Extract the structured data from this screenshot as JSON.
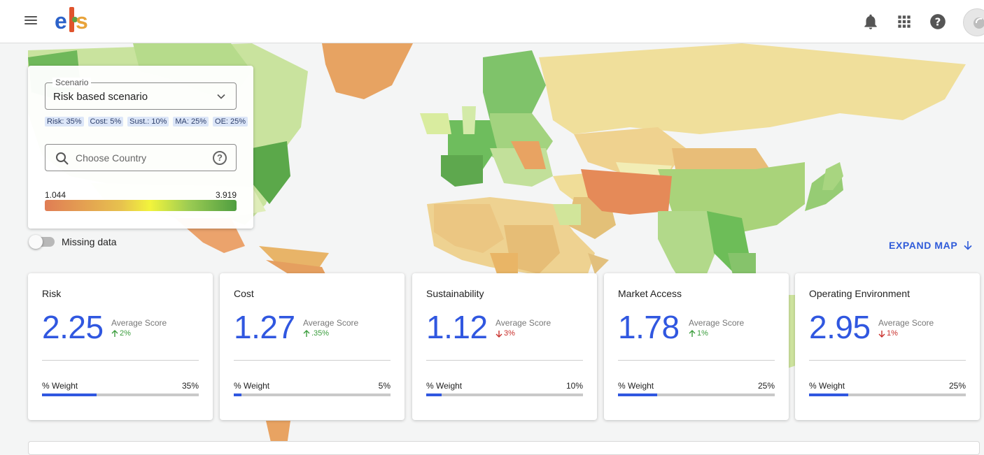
{
  "header": {
    "logo_text": "els",
    "icons": [
      "menu-icon",
      "bell-icon",
      "apps-grid-icon",
      "help-icon",
      "avatar"
    ]
  },
  "scenario": {
    "legend": "Scenario",
    "selected": "Risk based scenario",
    "weights": [
      "Risk: 35%",
      "Cost: 5%",
      "Sust.: 10%",
      "MA: 25%",
      "OE: 25%"
    ]
  },
  "search": {
    "placeholder": "Choose Country",
    "help": "?"
  },
  "scale": {
    "min": "1.044",
    "max": "3.919",
    "colors": [
      "#e07d55",
      "#e7c24e",
      "#f2f43c",
      "#9ccc53",
      "#4f9e40"
    ]
  },
  "missing_data": {
    "label": "Missing data",
    "enabled": false
  },
  "expand_map": {
    "label": "EXPAND MAP"
  },
  "accent_color": "#3057e0",
  "cards": [
    {
      "title": "Risk",
      "score": "2.25",
      "sub": "Average Score",
      "change": "2%",
      "direction": "up",
      "weight_label": "% Weight",
      "weight": "35%",
      "weight_fraction": 0.35
    },
    {
      "title": "Cost",
      "score": "1.27",
      "sub": "Average Score",
      "change": ".35%",
      "direction": "up",
      "weight_label": "% Weight",
      "weight": "5%",
      "weight_fraction": 0.05
    },
    {
      "title": "Sustainability",
      "score": "1.12",
      "sub": "Average Score",
      "change": "3%",
      "direction": "down",
      "weight_label": "% Weight",
      "weight": "10%",
      "weight_fraction": 0.1
    },
    {
      "title": "Market Access",
      "score": "1.78",
      "sub": "Average Score",
      "change": "1%",
      "direction": "up",
      "weight_label": "% Weight",
      "weight": "25%",
      "weight_fraction": 0.25
    },
    {
      "title": "Operating Environment",
      "score": "2.95",
      "sub": "Average Score",
      "change": "1%",
      "direction": "down",
      "weight_label": "% Weight",
      "weight": "25%",
      "weight_fraction": 0.25
    }
  ]
}
